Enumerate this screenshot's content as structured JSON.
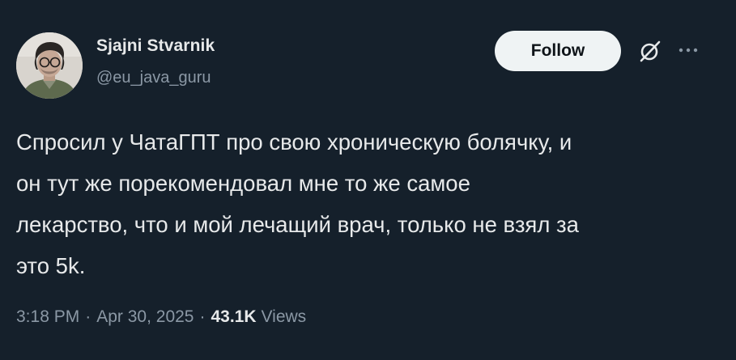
{
  "author": {
    "display_name": "Sjajni Stvarnik",
    "handle": "@eu_java_guru"
  },
  "header": {
    "follow_label": "Follow",
    "grok_icon": "grok-icon",
    "more_icon": "more-icon"
  },
  "tweet": {
    "text": "Спросил у ЧатаГПТ про свою хроническую болячку, и\nон тут же порекомендовал мне то же самое\nлекарство, что и мой лечащий врач, только не взял за\nэто 5k."
  },
  "meta": {
    "time": "3:18 PM",
    "separator": "·",
    "date": "Apr 30, 2025",
    "views_count": "43.1K",
    "views_label": "Views"
  },
  "colors": {
    "background": "#15202b",
    "text_primary": "#e7e9ea",
    "text_secondary": "#8b98a5",
    "follow_button_bg": "#eff3f4"
  }
}
